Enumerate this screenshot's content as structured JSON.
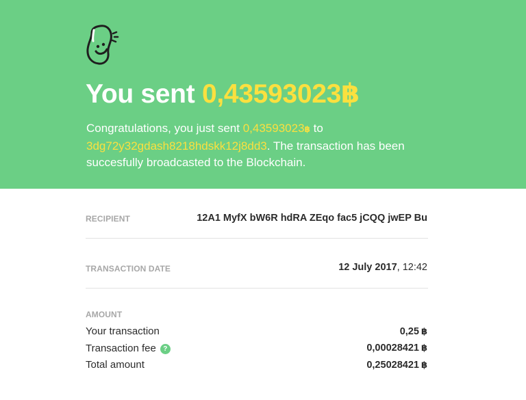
{
  "hero": {
    "headline_prefix": "You sent",
    "amount": "0,43593023",
    "currency_symbol": "฿",
    "message_part1": "Congratulations, you just sent",
    "message_amount": "0,43593023",
    "message_to": "to",
    "message_address": "3dg72y32gdash8218hdskk12j8dd3",
    "message_part2": ". The transaction has been succesfully broadcasted to the Blockchain.",
    "background_color": "#6bcf85",
    "highlight_color": "#fbe03f",
    "logo_icon": "smiling-bean-icon"
  },
  "details": {
    "recipient_label": "RECIPIENT",
    "recipient_value": "12A1 MyfX bW6R hdRA ZEqo fac5 jCQQ jwEP Bu",
    "date_label": "TRANSACTION DATE",
    "date_value": "12 July 2017",
    "time_value": ", 12:42",
    "amount_label": "AMOUNT",
    "lines": [
      {
        "label": "Your transaction",
        "value": "0,25"
      },
      {
        "label": "Transaction fee",
        "value": "0,00028421"
      },
      {
        "label": "Total amount",
        "value": "0,25028421"
      }
    ],
    "help_icon": "?"
  }
}
